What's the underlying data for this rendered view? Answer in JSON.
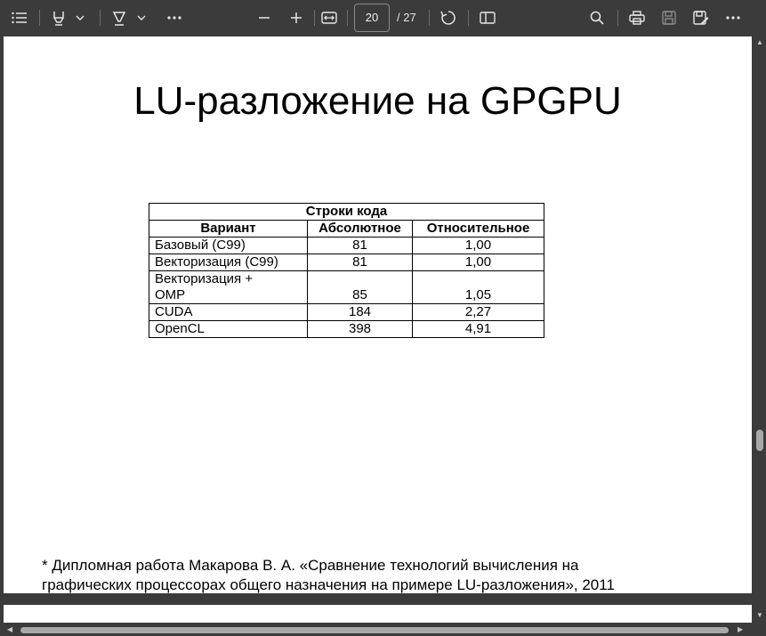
{
  "toolbar": {
    "icons": [
      "contents-icon",
      "highlight-icon",
      "chevron-down-icon",
      "draw-icon",
      "chevron-down-icon",
      "more-tools-icon",
      "zoom-out-icon",
      "zoom-in-icon",
      "fit-page-icon",
      "rotate-icon",
      "page-view-icon",
      "search-icon",
      "print-icon",
      "save-icon",
      "save-as-icon",
      "more-icon"
    ],
    "page_number": "20",
    "page_total": "/ 27"
  },
  "slide": {
    "title": "LU-разложение на GPGPU",
    "table": {
      "group_header": "Строки кода",
      "columns": [
        "Вариант",
        "Абсолютное",
        "Относительное"
      ],
      "rows": [
        [
          "Базовый (C99)",
          "81",
          "1,00"
        ],
        [
          "Векторизация (C99)",
          "81",
          "1,00"
        ],
        [
          "Векторизация +",
          "",
          ""
        ],
        [
          "OMP",
          "85",
          "1,05"
        ],
        [
          "CUDA",
          "184",
          "2,27"
        ],
        [
          "OpenCL",
          "398",
          "4,91"
        ]
      ]
    },
    "footnote_line1": "* Дипломная работа Макарова В. А. «Сравнение технологий вычисления на",
    "footnote_line2": "графических процессорах общего назначения на примере LU-разложения», 2011"
  }
}
